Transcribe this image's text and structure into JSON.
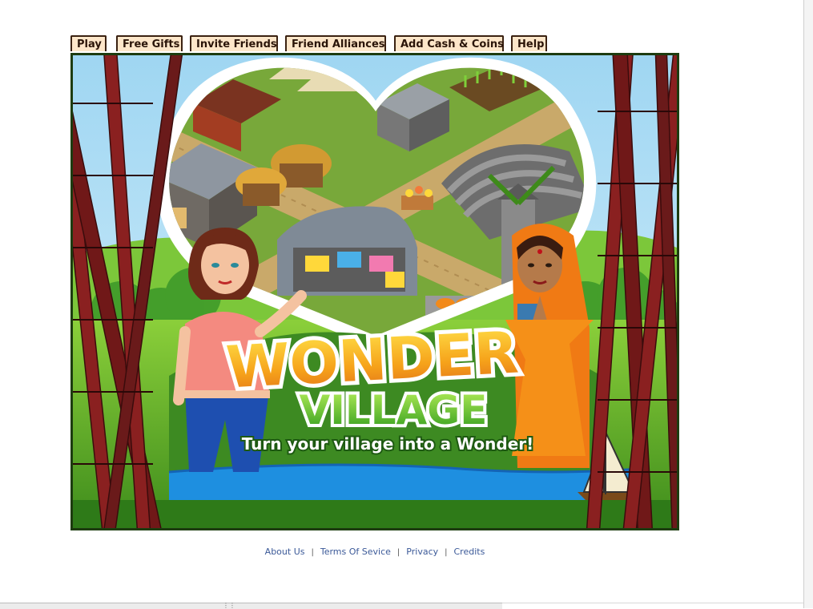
{
  "tabs": [
    {
      "label": "Play"
    },
    {
      "label": "Free Gifts"
    },
    {
      "label": "Invite Friends"
    },
    {
      "label": "Friend Alliances"
    },
    {
      "label": "Add Cash & Coins"
    },
    {
      "label": "Help"
    }
  ],
  "game": {
    "logo_line1": "WONDER",
    "logo_line2": "VILLAGE",
    "tagline": "Turn your village into a Wonder!"
  },
  "footer": {
    "links": [
      "About Us",
      "Terms Of Sevice",
      "Privacy",
      "Credits"
    ],
    "separator": "|"
  },
  "colors": {
    "tab_bg": "#fde6c9",
    "tab_border": "#3b2212",
    "frame_border": "#1d3c10",
    "link": "#3b5998",
    "logo_orange": "#f6a21a",
    "logo_green": "#2e9a1c"
  }
}
